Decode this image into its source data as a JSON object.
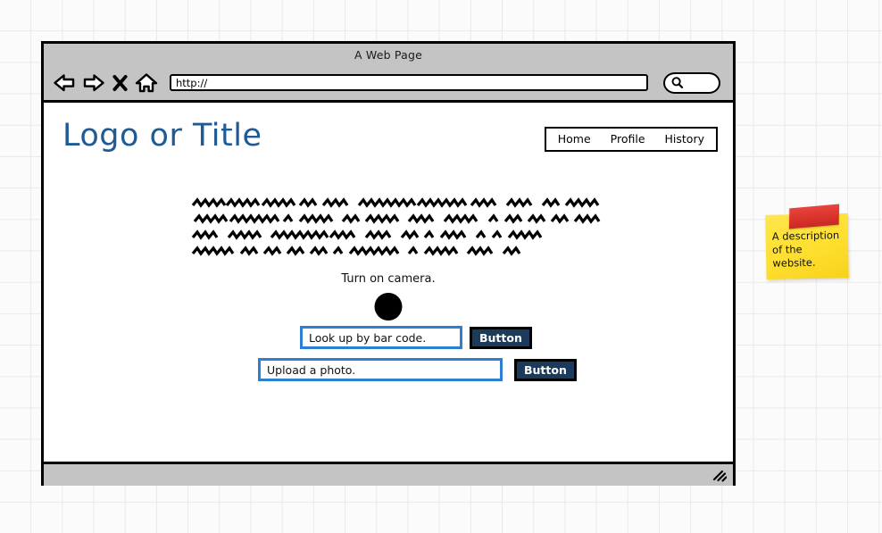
{
  "browser": {
    "window_title": "A Web Page",
    "toolbar": {
      "back_icon": "back-arrow-icon",
      "forward_icon": "forward-arrow-icon",
      "stop_icon": "stop-x-icon",
      "home_icon": "home-icon",
      "url_value": "http://",
      "url_placeholder": "http://",
      "search_icon": "magnifier-icon"
    },
    "status_bar": {
      "resize_grip_icon": "resize-grip-icon"
    }
  },
  "page": {
    "logo_title": "Logo or Title",
    "nav": {
      "links": [
        {
          "label": "Home"
        },
        {
          "label": "Profile"
        },
        {
          "label": "History"
        }
      ]
    },
    "body_text": {
      "type": "scribble-placeholder",
      "lines": 4
    },
    "camera": {
      "label": "Turn on camera.",
      "button_icon": "camera-dot-icon"
    },
    "rows": [
      {
        "input_name": "barcode-input",
        "input_value": "Look up by bar code.",
        "input_placeholder": "Look up by bar code.",
        "button_label": "Button"
      },
      {
        "input_name": "upload-input",
        "input_value": "Upload a photo.",
        "input_placeholder": "Upload a photo.",
        "button_label": "Button"
      }
    ]
  },
  "annotation": {
    "sticky_note_text": "A description\nof the website.",
    "tape_icon": "red-tape-icon"
  },
  "colors": {
    "title_blue": "#205a94",
    "input_border_blue": "#2e7fd4",
    "button_navy": "#1b3a5c",
    "chrome_gray": "#c4c4c4",
    "sticky_yellow": "#ffe13f",
    "tape_red": "#d8322b",
    "grid_line": "#e9e9e9"
  }
}
